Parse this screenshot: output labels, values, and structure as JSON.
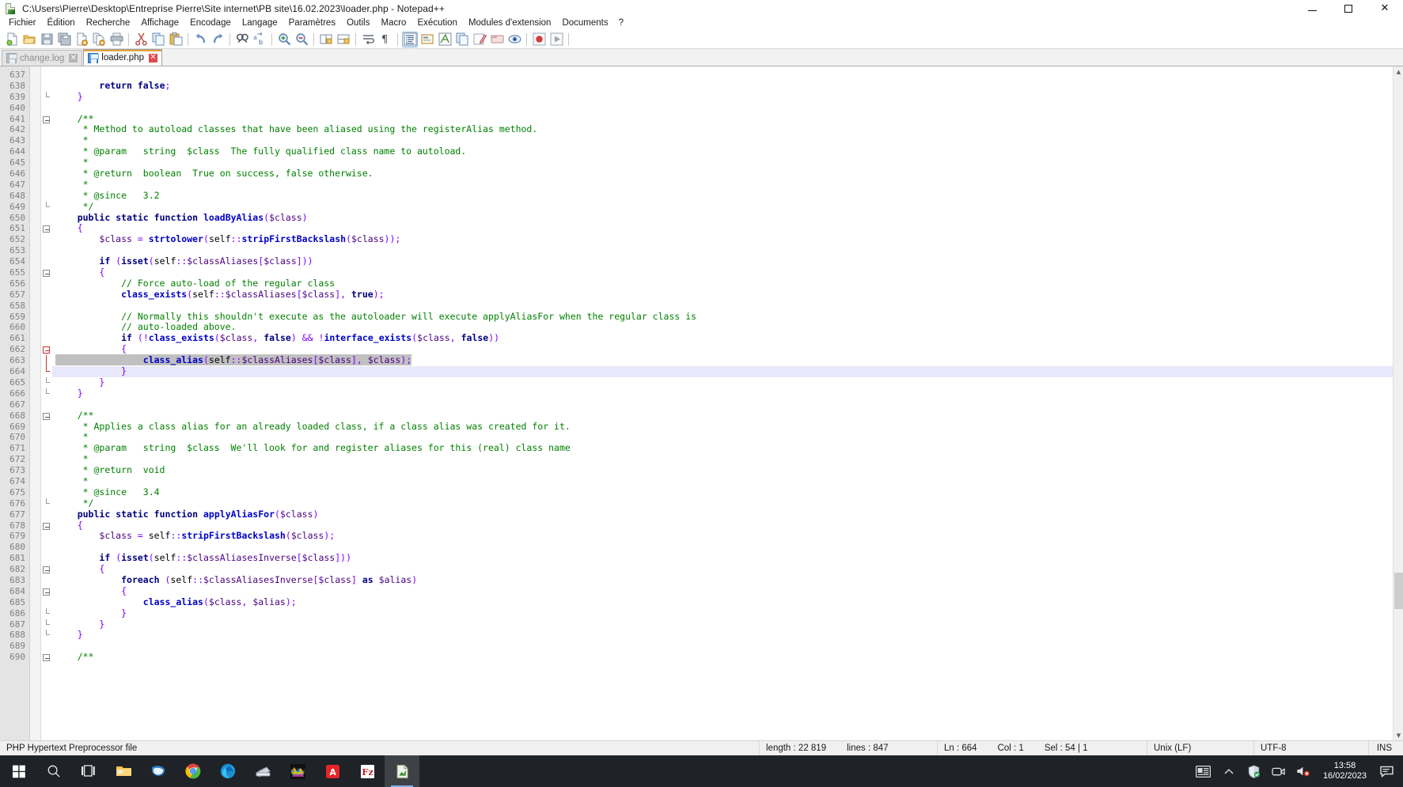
{
  "window": {
    "title": "C:\\Users\\Pierre\\Desktop\\Entreprise Pierre\\Site internet\\PB site\\16.02.2023\\loader.php - Notepad++",
    "icon": "notepadpp-icon",
    "controls": {
      "minimize": "–",
      "maximize": "□",
      "close": "✕"
    }
  },
  "menubar": {
    "items": [
      {
        "label": "Fichier"
      },
      {
        "label": "Édition"
      },
      {
        "label": "Recherche"
      },
      {
        "label": "Affichage"
      },
      {
        "label": "Encodage"
      },
      {
        "label": "Langage"
      },
      {
        "label": "Paramètres"
      },
      {
        "label": "Outils"
      },
      {
        "label": "Macro"
      },
      {
        "label": "Exécution"
      },
      {
        "label": "Modules d'extension"
      },
      {
        "label": "Documents"
      },
      {
        "label": "?"
      }
    ]
  },
  "toolbar": {
    "buttons": [
      {
        "name": "new-file-icon",
        "tip": "Nouveau"
      },
      {
        "name": "open-file-icon",
        "tip": "Ouvrir"
      },
      {
        "name": "save-icon",
        "tip": "Enregistrer"
      },
      {
        "name": "save-all-icon",
        "tip": "Tout enregistrer"
      },
      {
        "name": "close-file-icon",
        "tip": "Fermer"
      },
      {
        "name": "close-all-icon",
        "tip": "Tout fermer"
      },
      {
        "name": "print-icon",
        "tip": "Imprimer"
      },
      {
        "name": "cut-icon",
        "tip": "Couper"
      },
      {
        "name": "copy-icon",
        "tip": "Copier"
      },
      {
        "name": "paste-icon",
        "tip": "Coller"
      },
      {
        "name": "undo-icon",
        "tip": "Annuler"
      },
      {
        "name": "redo-icon",
        "tip": "Rétablir"
      },
      {
        "name": "find-icon",
        "tip": "Rechercher"
      },
      {
        "name": "replace-icon",
        "tip": "Remplacer"
      },
      {
        "name": "zoom-in-icon",
        "tip": "Zoom avant"
      },
      {
        "name": "zoom-out-icon",
        "tip": "Zoom arrière"
      },
      {
        "name": "sync-vertical-icon",
        "tip": "Défilement vertical synchronisé"
      },
      {
        "name": "sync-horizontal-icon",
        "tip": "Défilement horizontal synchronisé"
      },
      {
        "name": "word-wrap-icon",
        "tip": "Retour à la ligne"
      },
      {
        "name": "show-all-chars-icon",
        "tip": "Afficher tous les caractères"
      },
      {
        "name": "indent-guide-icon",
        "tip": "Guides d'indentation"
      },
      {
        "name": "user-defined-lang-icon",
        "tip": "Langage défini par l'utilisateur"
      },
      {
        "name": "function-list-icon",
        "tip": "Liste des fonctions"
      },
      {
        "name": "document-map-icon",
        "tip": "Plan du document"
      },
      {
        "name": "doc-switcher-icon",
        "tip": "Sélecteur de documents"
      },
      {
        "name": "macro-record-icon",
        "tip": "Enregistrer macro"
      },
      {
        "name": "macro-folder-icon",
        "tip": "Dossier en tant qu'espace de travail"
      },
      {
        "name": "monitor-icon",
        "tip": "Surveiller"
      },
      {
        "name": "macro-stop-icon",
        "tip": "Arrêter l'enregistrement"
      },
      {
        "name": "macro-play-icon",
        "tip": "Exécuter la macro"
      }
    ]
  },
  "tabs": [
    {
      "label": "change.log",
      "active": false,
      "icon": "save-blue-icon",
      "close": "✕"
    },
    {
      "label": "loader.php",
      "active": true,
      "icon": "save-blue-icon",
      "close": "✕"
    }
  ],
  "editor": {
    "first_line_number": 637,
    "current_line": 664,
    "selected_line": 663,
    "lines": [
      {
        "n": 637,
        "text": ""
      },
      {
        "n": 638,
        "text": "        return false;"
      },
      {
        "n": 639,
        "text": "    }"
      },
      {
        "n": 640,
        "text": ""
      },
      {
        "n": 641,
        "text": "    /**"
      },
      {
        "n": 642,
        "text": "     * Method to autoload classes that have been aliased using the registerAlias method."
      },
      {
        "n": 643,
        "text": "     *"
      },
      {
        "n": 644,
        "text": "     * @param   string  $class  The fully qualified class name to autoload."
      },
      {
        "n": 645,
        "text": "     *"
      },
      {
        "n": 646,
        "text": "     * @return  boolean  True on success, false otherwise."
      },
      {
        "n": 647,
        "text": "     *"
      },
      {
        "n": 648,
        "text": "     * @since   3.2"
      },
      {
        "n": 649,
        "text": "     */"
      },
      {
        "n": 650,
        "text": "    public static function loadByAlias($class)"
      },
      {
        "n": 651,
        "text": "    {"
      },
      {
        "n": 652,
        "text": "        $class = strtolower(self::stripFirstBackslash($class));"
      },
      {
        "n": 653,
        "text": ""
      },
      {
        "n": 654,
        "text": "        if (isset(self::$classAliases[$class]))"
      },
      {
        "n": 655,
        "text": "        {"
      },
      {
        "n": 656,
        "text": "            // Force auto-load of the regular class"
      },
      {
        "n": 657,
        "text": "            class_exists(self::$classAliases[$class], true);"
      },
      {
        "n": 658,
        "text": ""
      },
      {
        "n": 659,
        "text": "            // Normally this shouldn't execute as the autoloader will execute applyAliasFor when the regular class is"
      },
      {
        "n": 660,
        "text": "            // auto-loaded above."
      },
      {
        "n": 661,
        "text": "            if (!class_exists($class, false) && !interface_exists($class, false))"
      },
      {
        "n": 662,
        "text": "            {"
      },
      {
        "n": 663,
        "text": "                class_alias(self::$classAliases[$class], $class);"
      },
      {
        "n": 664,
        "text": "            }"
      },
      {
        "n": 665,
        "text": "        }"
      },
      {
        "n": 666,
        "text": "    }"
      },
      {
        "n": 667,
        "text": ""
      },
      {
        "n": 668,
        "text": "    /**"
      },
      {
        "n": 669,
        "text": "     * Applies a class alias for an already loaded class, if a class alias was created for it."
      },
      {
        "n": 670,
        "text": "     *"
      },
      {
        "n": 671,
        "text": "     * @param   string  $class  We'll look for and register aliases for this (real) class name"
      },
      {
        "n": 672,
        "text": "     *"
      },
      {
        "n": 673,
        "text": "     * @return  void"
      },
      {
        "n": 674,
        "text": "     *"
      },
      {
        "n": 675,
        "text": "     * @since   3.4"
      },
      {
        "n": 676,
        "text": "     */"
      },
      {
        "n": 677,
        "text": "    public static function applyAliasFor($class)"
      },
      {
        "n": 678,
        "text": "    {"
      },
      {
        "n": 679,
        "text": "        $class = self::stripFirstBackslash($class);"
      },
      {
        "n": 680,
        "text": ""
      },
      {
        "n": 681,
        "text": "        if (isset(self::$classAliasesInverse[$class]))"
      },
      {
        "n": 682,
        "text": "        {"
      },
      {
        "n": 683,
        "text": "            foreach (self::$classAliasesInverse[$class] as $alias)"
      },
      {
        "n": 684,
        "text": "            {"
      },
      {
        "n": 685,
        "text": "                class_alias($class, $alias);"
      },
      {
        "n": 686,
        "text": "            }"
      },
      {
        "n": 687,
        "text": "        }"
      },
      {
        "n": 688,
        "text": "    }"
      },
      {
        "n": 689,
        "text": ""
      },
      {
        "n": 690,
        "text": "    /**"
      }
    ]
  },
  "statusbar": {
    "doc_type": "PHP Hypertext Preprocessor file",
    "length_label": "length : 22 819",
    "lines_label": "lines : 847",
    "ln": "Ln : 664",
    "col": "Col : 1",
    "sel": "Sel : 54 | 1",
    "eol": "Unix (LF)",
    "encoding": "UTF-8",
    "insert_mode": "INS"
  },
  "scrollbar": {
    "up_arrow": "▲",
    "down_arrow": "▼"
  },
  "taskbar": {
    "items": [
      {
        "name": "start-button-icon",
        "label": "Démarrer"
      },
      {
        "name": "search-icon",
        "label": "Rechercher"
      },
      {
        "name": "task-view-icon",
        "label": "Affichage des tâches"
      },
      {
        "name": "file-explorer-icon",
        "label": "Explorateur de fichiers"
      },
      {
        "name": "mail-icon",
        "label": "Courrier"
      },
      {
        "name": "chrome-icon",
        "label": "Google Chrome"
      },
      {
        "name": "edge-icon",
        "label": "Microsoft Edge"
      },
      {
        "name": "scanner-icon",
        "label": "Scanner"
      },
      {
        "name": "image-editor-icon",
        "label": "Éditeur d'images"
      },
      {
        "name": "acrobat-icon",
        "label": "Adobe Acrobat"
      },
      {
        "name": "filezilla-icon",
        "label": "FileZilla"
      },
      {
        "name": "notepadpp-taskbar-icon",
        "label": "Notepad++",
        "running": true
      }
    ],
    "tray": {
      "news_icon": "news-and-interests-icon",
      "chevron": "∧",
      "defender_icon": "windows-security-icon",
      "camera_icon": "camera-icon",
      "volume_icon": "volume-muted-icon",
      "time": "13:58",
      "date": "16/02/2023",
      "notifications_icon": "notification-center-icon"
    }
  }
}
